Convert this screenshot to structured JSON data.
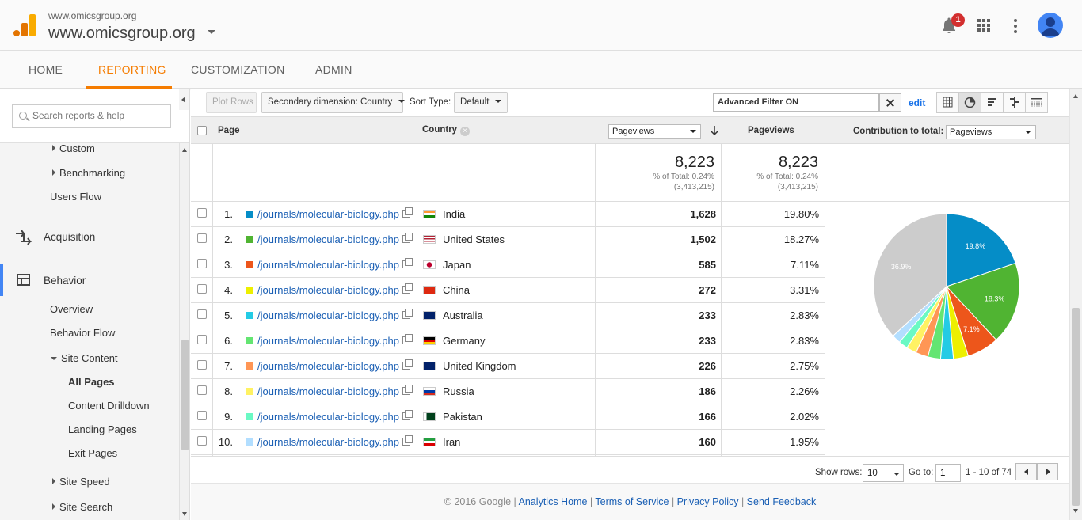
{
  "header": {
    "property_small": "www.omicsgroup.org",
    "property_large": "www.omicsgroup.org",
    "notification_count": "1",
    "icons": [
      "bell-icon",
      "apps-grid-icon",
      "more-vert-icon",
      "avatar-icon"
    ]
  },
  "nav": {
    "tabs": [
      {
        "label": "HOME"
      },
      {
        "label": "REPORTING",
        "active": true
      },
      {
        "label": "CUSTOMIZATION"
      },
      {
        "label": "ADMIN"
      }
    ],
    "accent": "#f57c00"
  },
  "sidebar": {
    "search_placeholder": "Search reports & help",
    "items": {
      "custom": "Custom",
      "benchmarking": "Benchmarking",
      "users_flow": "Users Flow",
      "acquisition": "Acquisition",
      "behavior": "Behavior",
      "overview": "Overview",
      "behavior_flow": "Behavior Flow",
      "site_content": "Site Content",
      "all_pages": "All Pages",
      "content_drilldown": "Content Drilldown",
      "landing_pages": "Landing Pages",
      "exit_pages": "Exit Pages",
      "site_speed": "Site Speed",
      "site_search": "Site Search"
    }
  },
  "toolbar": {
    "plot_rows": "Plot Rows",
    "secondary_dimension": "Secondary dimension: Country",
    "sort_type_label": "Sort Type:",
    "sort_type_value": "Default",
    "filter_text": "Advanced Filter ON",
    "edit": "edit"
  },
  "table": {
    "headers": {
      "page": "Page",
      "country": "Country",
      "metric_select": "Pageviews",
      "pageviews": "Pageviews",
      "contribution_label": "Contribution to total:",
      "contribution_select": "Pageviews"
    },
    "totals": {
      "value1": "8,223",
      "pct1": "% of Total: 0.24%",
      "abs1": "(3,413,215)",
      "value2": "8,223",
      "pct2": "% of Total: 0.24%",
      "abs2": "(3,413,215)"
    },
    "rows": [
      {
        "rank": "1.",
        "page": "/journals/molecular-biology.php",
        "country": "India",
        "pageviews": "1,628",
        "pct": "19.80%",
        "color": "#058dc7"
      },
      {
        "rank": "2.",
        "page": "/journals/molecular-biology.php",
        "country": "United States",
        "pageviews": "1,502",
        "pct": "18.27%",
        "color": "#50b432"
      },
      {
        "rank": "3.",
        "page": "/journals/molecular-biology.php",
        "country": "Japan",
        "pageviews": "585",
        "pct": "7.11%",
        "color": "#ed561b"
      },
      {
        "rank": "4.",
        "page": "/journals/molecular-biology.php",
        "country": "China",
        "pageviews": "272",
        "pct": "3.31%",
        "color": "#edef00"
      },
      {
        "rank": "5.",
        "page": "/journals/molecular-biology.php",
        "country": "Australia",
        "pageviews": "233",
        "pct": "2.83%",
        "color": "#24cbe5"
      },
      {
        "rank": "6.",
        "page": "/journals/molecular-biology.php",
        "country": "Germany",
        "pageviews": "233",
        "pct": "2.83%",
        "color": "#64e572"
      },
      {
        "rank": "7.",
        "page": "/journals/molecular-biology.php",
        "country": "United Kingdom",
        "pageviews": "226",
        "pct": "2.75%",
        "color": "#ff9655"
      },
      {
        "rank": "8.",
        "page": "/journals/molecular-biology.php",
        "country": "Russia",
        "pageviews": "186",
        "pct": "2.26%",
        "color": "#fff263"
      },
      {
        "rank": "9.",
        "page": "/journals/molecular-biology.php",
        "country": "Pakistan",
        "pageviews": "166",
        "pct": "2.02%",
        "color": "#6af9c4"
      },
      {
        "rank": "10.",
        "page": "/journals/molecular-biology.php",
        "country": "Iran",
        "pageviews": "160",
        "pct": "1.95%",
        "color": "#b2deff"
      }
    ]
  },
  "chart_data": {
    "type": "pie",
    "values": [
      19.8,
      18.27,
      7.11,
      3.31,
      2.83,
      2.83,
      2.75,
      2.26,
      2.02,
      1.95,
      36.87
    ],
    "colors": [
      "#058dc7",
      "#50b432",
      "#ed561b",
      "#edef00",
      "#24cbe5",
      "#64e572",
      "#ff9655",
      "#fff263",
      "#6af9c4",
      "#b2deff",
      "#cccccc"
    ],
    "slice_labels": [
      "19.8%",
      "18.3%",
      "7.1%",
      "",
      "",
      "",
      "",
      "",
      "",
      "",
      "36.9%"
    ]
  },
  "pagination": {
    "show_rows_label": "Show rows:",
    "rows_value": "10",
    "goto_label": "Go to:",
    "goto_value": "1",
    "range": "1 - 10 of 74"
  },
  "footer": {
    "copyright": "© 2016 Google",
    "links": [
      "Analytics Home",
      "Terms of Service",
      "Privacy Policy",
      "Send Feedback"
    ]
  }
}
